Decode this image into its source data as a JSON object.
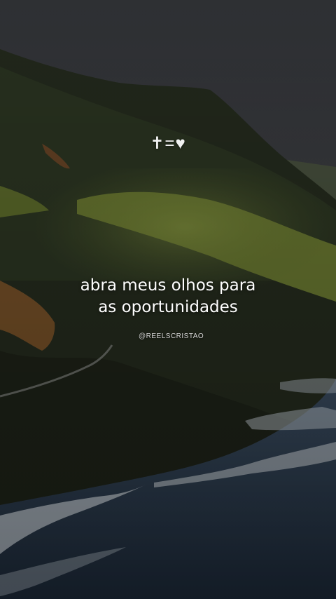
{
  "logo": {
    "cross": "✝",
    "equals": "=",
    "heart": "♥"
  },
  "quote": {
    "line1": "abra meus olhos para",
    "line2": "as oportunidades"
  },
  "handle": "@REELSCRISTAO",
  "colors": {
    "sky": "#3a3c40",
    "hill": "#3d4a2b",
    "highlight": "#7b8a3a",
    "sea": "#314257",
    "foam": "#cfd6dc"
  }
}
